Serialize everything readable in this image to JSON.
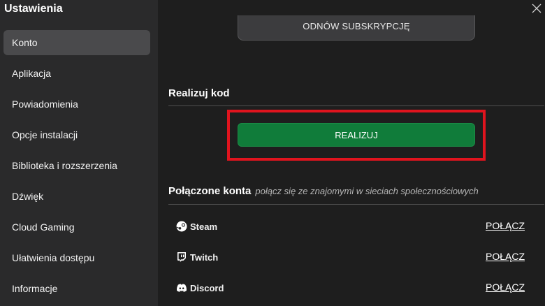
{
  "sidebar": {
    "title": "Ustawienia",
    "items": [
      {
        "label": "Konto",
        "active": true
      },
      {
        "label": "Aplikacja"
      },
      {
        "label": "Powiadomienia"
      },
      {
        "label": "Opcje instalacji"
      },
      {
        "label": "Biblioteka i rozszerzenia"
      },
      {
        "label": "Dźwięk"
      },
      {
        "label": "Cloud Gaming"
      },
      {
        "label": "Ułatwienia dostępu"
      },
      {
        "label": "Informacje"
      }
    ]
  },
  "main": {
    "top_button_label": "ODNÓW SUBSKRYPCJĘ",
    "redeem": {
      "title": "Realizuj kod",
      "button_label": "REALIZUJ"
    },
    "linked_accounts": {
      "title": "Połączone konta",
      "subtitle": "połącz się ze znajomymi w sieciach społecznościowych",
      "accounts": [
        {
          "name": "Steam",
          "icon": "steam-icon",
          "action": "POŁĄCZ"
        },
        {
          "name": "Twitch",
          "icon": "twitch-icon",
          "action": "POŁĄCZ"
        },
        {
          "name": "Discord",
          "icon": "discord-icon",
          "action": "POŁĄCZ"
        }
      ]
    }
  },
  "colors": {
    "sidebar_bg": "#2a2a2b",
    "main_bg": "#1e1e1e",
    "active_item": "#4a4a4c",
    "accent_green": "#107c3a",
    "highlight_red": "#e0141e"
  }
}
